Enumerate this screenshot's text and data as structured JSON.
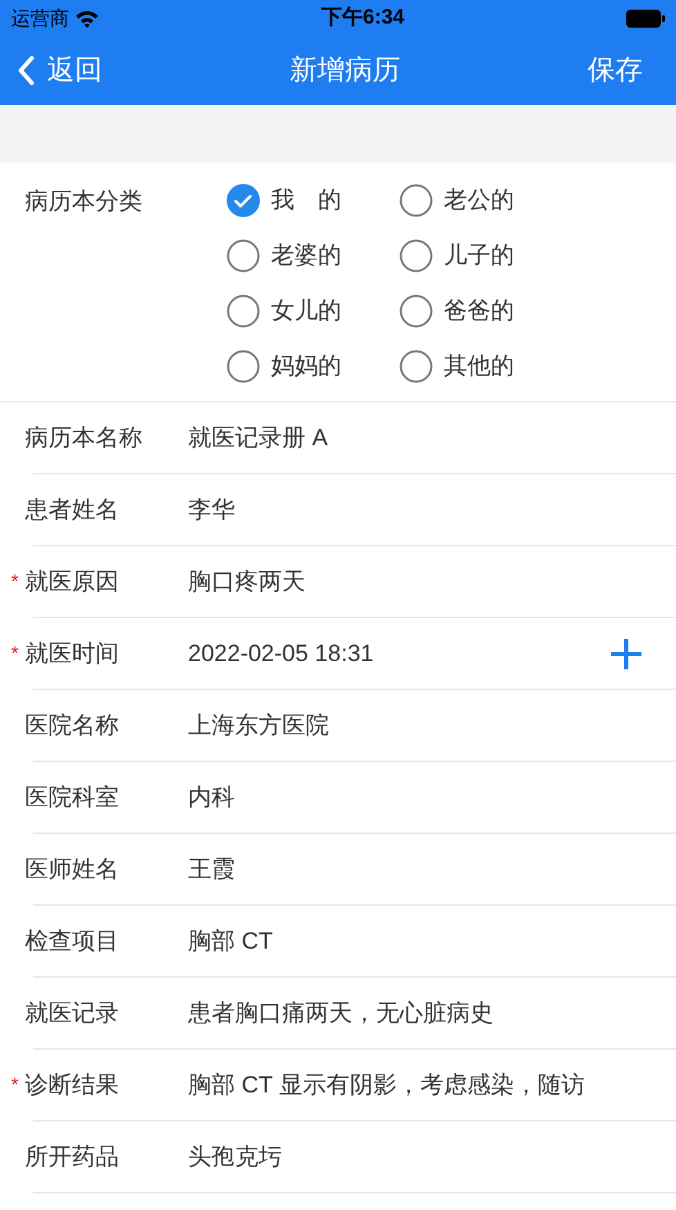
{
  "status_bar": {
    "carrier": "运营商",
    "time": "下午6:34"
  },
  "nav": {
    "back": "返回",
    "title": "新增病历",
    "action": "保存"
  },
  "category": {
    "label": "病历本分类",
    "options": [
      {
        "label": "我　的",
        "selected": true
      },
      {
        "label": "老公的",
        "selected": false
      },
      {
        "label": "老婆的",
        "selected": false
      },
      {
        "label": "儿子的",
        "selected": false
      },
      {
        "label": "女儿的",
        "selected": false
      },
      {
        "label": "爸爸的",
        "selected": false
      },
      {
        "label": "妈妈的",
        "selected": false
      },
      {
        "label": "其他的",
        "selected": false
      }
    ]
  },
  "fields": [
    {
      "kind": "text",
      "label": "病历本名称",
      "value": "就医记录册 A"
    },
    {
      "kind": "text",
      "label": "患者姓名",
      "value": "李华"
    },
    {
      "kind": "text",
      "label": "就医原因",
      "value": "胸口疼两天",
      "required_mark": "*"
    },
    {
      "kind": "datetime",
      "label": "就医时间",
      "value": "2022-02-05 18:31",
      "required_mark": "*"
    },
    {
      "kind": "text",
      "label": "医院名称",
      "value": "上海东方医院"
    },
    {
      "kind": "text",
      "label": "医院科室",
      "value": "内科"
    },
    {
      "kind": "text",
      "label": "医师姓名",
      "value": "王霞"
    },
    {
      "kind": "text",
      "label": "检查项目",
      "value": "胸部 CT"
    },
    {
      "kind": "text",
      "label": "就医记录",
      "value": "患者胸口痛两天，无心脏病史"
    },
    {
      "kind": "text",
      "label": "诊断结果",
      "value": "胸部 CT 显示有阴影，考虑感染，随访",
      "required_mark": "*"
    },
    {
      "kind": "text",
      "label": "所开药品",
      "value": "头孢克圬"
    }
  ]
}
